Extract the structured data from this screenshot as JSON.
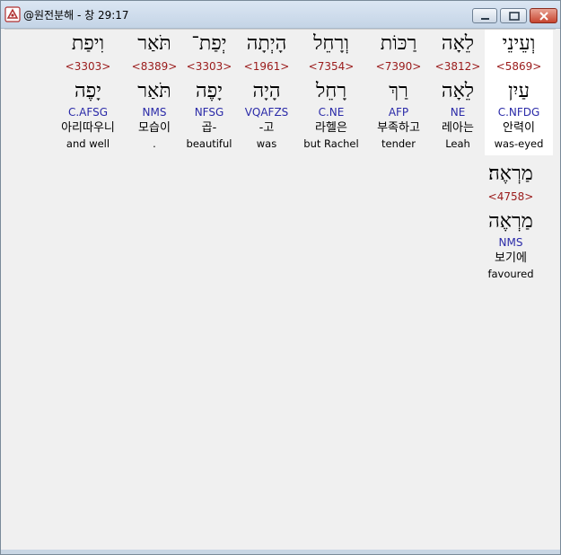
{
  "window": {
    "title": "@원전분해 - 창 29:17"
  },
  "words": [
    {
      "heb": "וְעֵינֵי",
      "strong": "<5869>",
      "lemma": "עַיִן",
      "parse": "C.NFDG",
      "korean": "안력이",
      "english": "was-eyed",
      "selected": true
    },
    {
      "heb": "לֵאָה",
      "strong": "<3812>",
      "lemma": "לֵאָה",
      "parse": "NE",
      "korean": "레아는",
      "english": "Leah"
    },
    {
      "heb": "רַכּוֹת",
      "strong": "<7390>",
      "lemma": "רַךְ",
      "parse": "AFP",
      "korean": "부족하고",
      "english": "tender"
    },
    {
      "heb": "וְרָחֵל",
      "strong": "<7354>",
      "lemma": "רָחֵל",
      "parse": "C.NE",
      "korean": "라헬은",
      "english": "but Rachel"
    },
    {
      "heb": "הָיְתָה",
      "strong": "<1961>",
      "lemma": "הָיָה",
      "parse": "VQAFZS",
      "korean": "-고",
      "english": "was"
    },
    {
      "heb": "יְפַת־",
      "strong": "<3303>",
      "lemma": "יָפֶה",
      "parse": "NFSG",
      "korean": "곱-",
      "english": "beautiful"
    },
    {
      "heb": "תֹּאַר",
      "strong": "<8389>",
      "lemma": "תֹּאַר",
      "parse": "NMS",
      "korean": "모습이",
      "english": "."
    },
    {
      "heb": "וִיפַת",
      "strong": "<3303>",
      "lemma": "יָפֶה",
      "parse": "C.AFSG",
      "korean": "아리따우니",
      "english": "and well"
    },
    {
      "heb": "מַרְאֶה׃",
      "strong": "<4758>",
      "lemma": "מַרְאֶה",
      "parse": "NMS",
      "korean": "보기에",
      "english": "favoured"
    }
  ]
}
